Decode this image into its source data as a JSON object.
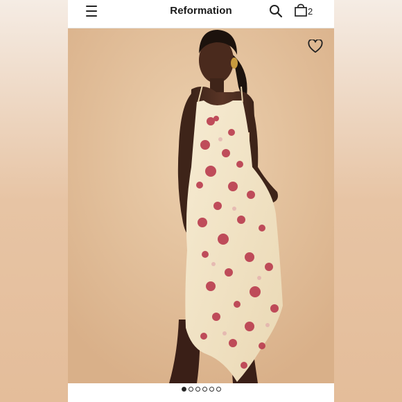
{
  "header": {
    "brand": "Reformation",
    "menu_icon": "hamburger-menu-icon",
    "search_icon": "search-icon",
    "bag_icon": "shopping-bag-icon",
    "bag_count": "2"
  },
  "product": {
    "image": "woman-in-floral-slip-dress-photo",
    "favorite_icon": "heart-icon",
    "carousel": {
      "total": 6,
      "active": 1
    }
  },
  "colors": {
    "background": "#e6c39f",
    "dress": "#f3e5c6",
    "print": "#b8374b"
  }
}
